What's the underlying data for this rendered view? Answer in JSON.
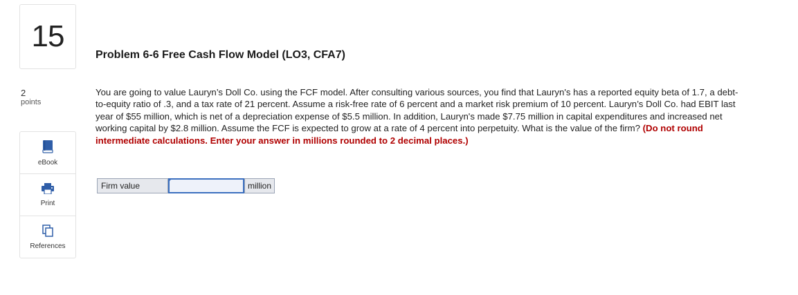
{
  "question": {
    "number": "15",
    "points_value": "2",
    "points_label": "points"
  },
  "tools": [
    {
      "label": "eBook",
      "icon": "book-icon"
    },
    {
      "label": "Print",
      "icon": "printer-icon"
    },
    {
      "label": "References",
      "icon": "documents-icon"
    }
  ],
  "problem": {
    "title": "Problem 6-6 Free Cash Flow Model (LO3, CFA7)",
    "body": "You are going to value Lauryn’s Doll Co. using the FCF model. After consulting various sources, you find that Lauryn's has a reported equity beta of 1.7, a debt-to-equity ratio of .3, and a tax rate of 21 percent. Assume a risk-free rate of 6 percent and a market risk premium of 10 percent. Lauryn’s Doll Co. had EBIT last year of $55 million, which is net of a depreciation expense of $5.5 million. In addition, Lauryn's made $7.75 million in capital expenditures and increased net working capital by $2.8 million. Assume the FCF is expected to grow at a rate of 4 percent into perpetuity. What is the value of the firm? ",
    "instruction": "(Do not round intermediate calculations. Enter your answer in millions rounded to 2 decimal places.)"
  },
  "answer": {
    "label": "Firm value",
    "value": "",
    "unit": "million"
  },
  "colors": {
    "instruction": "#b00000",
    "icon_blue": "#2f5ea8",
    "field_border": "#3b6fbf"
  }
}
